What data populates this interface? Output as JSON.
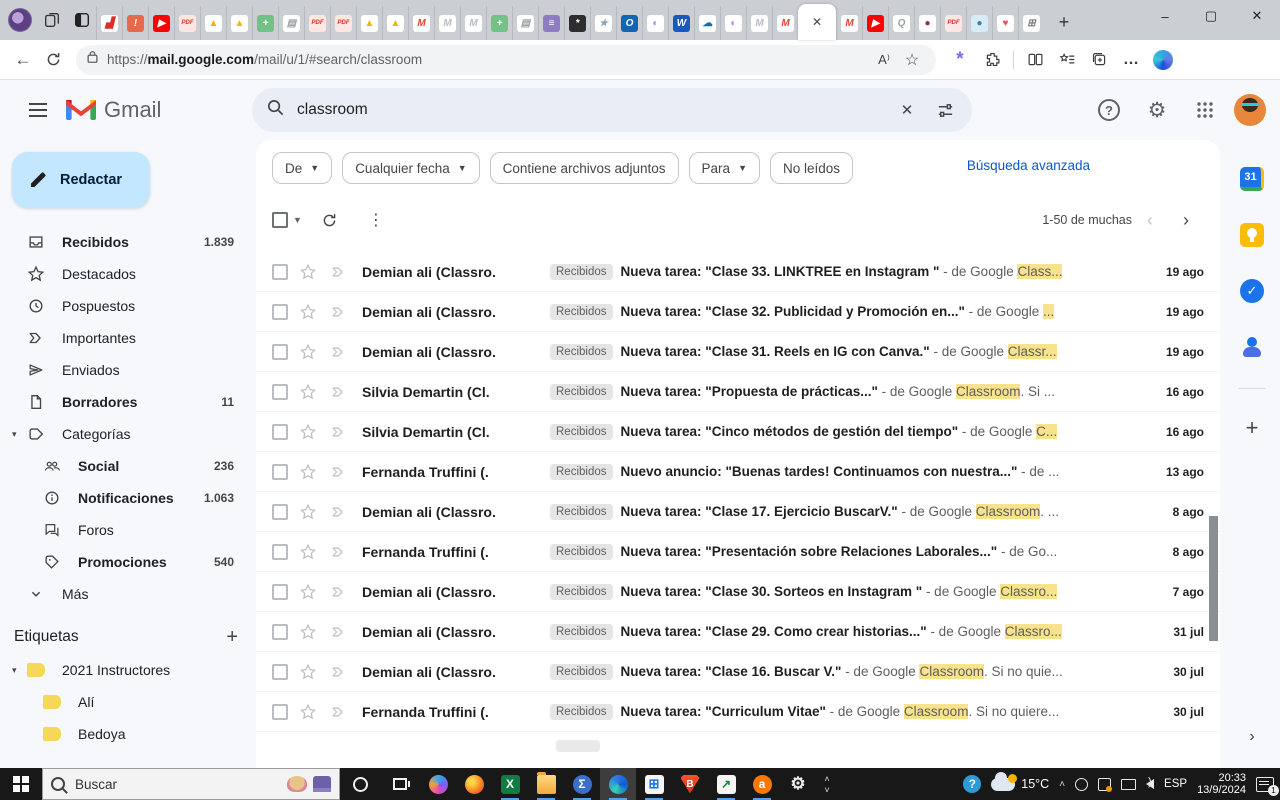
{
  "browser": {
    "window": {
      "minimize": "–",
      "maximize": "▢",
      "close": "✕"
    },
    "active_tab_close": "✕",
    "new_tab": "+",
    "tabs_before": [
      {
        "name": "analytics",
        "bg": "#ffffff",
        "fg": "#d93025",
        "g": "▟"
      },
      {
        "name": "alert-orange",
        "bg": "#e8684a",
        "fg": "#ffffff",
        "g": "!"
      },
      {
        "name": "youtube",
        "bg": "#ff0000",
        "fg": "#ffffff",
        "g": "▶"
      },
      {
        "name": "pdf",
        "bg": "#fde7e5",
        "fg": "#d93025",
        "g": "PDF"
      },
      {
        "name": "drive",
        "bg": "#ffffff",
        "fg": "#f4b400",
        "g": "▲"
      },
      {
        "name": "drive",
        "bg": "#ffffff",
        "fg": "#f4b400",
        "g": "▲"
      },
      {
        "name": "sheets",
        "bg": "#71c287",
        "fg": "#ffffff",
        "g": "+"
      },
      {
        "name": "doc",
        "bg": "#ffffff",
        "fg": "#9aa0a6",
        "g": "▤"
      },
      {
        "name": "pdf",
        "bg": "#fde7e5",
        "fg": "#d93025",
        "g": "PDF"
      },
      {
        "name": "pdf",
        "bg": "#fde7e5",
        "fg": "#d93025",
        "g": "PDF"
      },
      {
        "name": "drive",
        "bg": "#ffffff",
        "fg": "#f4b400",
        "g": "▲"
      },
      {
        "name": "drive",
        "bg": "#ffffff",
        "fg": "#f4b400",
        "g": "▲"
      },
      {
        "name": "gmail",
        "bg": "#ffffff",
        "fg": "#ea4335",
        "g": "M"
      },
      {
        "name": "mail-muted",
        "bg": "#ffffff",
        "fg": "#b5bdc9",
        "g": "M"
      },
      {
        "name": "mail-muted",
        "bg": "#ffffff",
        "fg": "#b5bdc9",
        "g": "M"
      },
      {
        "name": "sheets",
        "bg": "#71c287",
        "fg": "#ffffff",
        "g": "+"
      },
      {
        "name": "doc",
        "bg": "#ffffff",
        "fg": "#9aa0a6",
        "g": "▤"
      },
      {
        "name": "list-purple",
        "bg": "#8e7cc3",
        "fg": "#ffffff",
        "g": "≡"
      },
      {
        "name": "openai",
        "bg": "#2d2d2d",
        "fg": "#ffffff",
        "g": "*"
      },
      {
        "name": "star-muted",
        "bg": "#ffffff",
        "fg": "#8fa6b8",
        "g": "★"
      },
      {
        "name": "outlook",
        "bg": "#1066b5",
        "fg": "#ffffff",
        "g": "O"
      },
      {
        "name": "loop-purple",
        "bg": "#ffffff",
        "fg": "#9b8ae0",
        "g": "◐"
      },
      {
        "name": "word",
        "bg": "#185abd",
        "fg": "#ffffff",
        "g": "W"
      },
      {
        "name": "onedrive",
        "bg": "#ffffff",
        "fg": "#0f6cbd",
        "g": "☁"
      },
      {
        "name": "loop-purple",
        "bg": "#ffffff",
        "fg": "#9b8ae0",
        "g": "◐"
      },
      {
        "name": "mail-muted",
        "bg": "#ffffff",
        "fg": "#b5bdc9",
        "g": "M"
      },
      {
        "name": "gmail",
        "bg": "#ffffff",
        "fg": "#ea4335",
        "g": "M"
      }
    ],
    "tabs_after": [
      {
        "name": "gmail",
        "bg": "#ffffff",
        "fg": "#ea4335",
        "g": "M"
      },
      {
        "name": "youtube",
        "bg": "#ff0000",
        "fg": "#ffffff",
        "g": "▶"
      },
      {
        "name": "search-muted",
        "bg": "#ffffff",
        "fg": "#9aa0a6",
        "g": "Q"
      },
      {
        "name": "circle-darkred",
        "bg": "#ffffff",
        "fg": "#93323b",
        "g": "●"
      },
      {
        "name": "pdf",
        "bg": "#fde7e5",
        "fg": "#d93025",
        "g": "PDF"
      },
      {
        "name": "globe-blue",
        "bg": "#d8ecf7",
        "fg": "#3b82a8",
        "g": "●"
      },
      {
        "name": "heart",
        "bg": "#ffffff",
        "fg": "#e25563",
        "g": "♥"
      },
      {
        "name": "ms-grid",
        "bg": "#ffffff",
        "fg": "#7c7c7c",
        "g": "⊞"
      }
    ],
    "toolbar": {
      "back": "←",
      "url_scheme": "https://",
      "url_host": "mail.google.com",
      "url_path": "/mail/u/1/#search/classroom",
      "read_aloud": "A⁾",
      "favorite_star": "☆",
      "more": "…"
    }
  },
  "gmail": {
    "brand": "Gmail",
    "search": {
      "value": "classroom",
      "clear": "✕"
    },
    "compose": "Redactar",
    "filters": [
      {
        "label": "De",
        "dropdown": true
      },
      {
        "label": "Cualquier fecha",
        "dropdown": true
      },
      {
        "label": "Contiene archivos adjuntos",
        "dropdown": false
      },
      {
        "label": "Para",
        "dropdown": true
      },
      {
        "label": "No leídos",
        "dropdown": false
      }
    ],
    "advanced_search": "Búsqueda avanzada",
    "nav": [
      {
        "icon": "inbox",
        "label": "Recibidos",
        "count": "1.839",
        "bold": true
      },
      {
        "icon": "star",
        "label": "Destacados",
        "count": ""
      },
      {
        "icon": "clock",
        "label": "Pospuestos",
        "count": ""
      },
      {
        "icon": "important",
        "label": "Importantes",
        "count": ""
      },
      {
        "icon": "send",
        "label": "Enviados",
        "count": ""
      },
      {
        "icon": "doc",
        "label": "Borradores",
        "count": "11",
        "bold": true
      },
      {
        "icon": "tag",
        "label": "Categorías",
        "count": "",
        "expander": true
      },
      {
        "icon": "people",
        "label": "Social",
        "count": "236",
        "bold": true,
        "indent": true
      },
      {
        "icon": "info",
        "label": "Notificaciones",
        "count": "1.063",
        "bold": true,
        "indent": true
      },
      {
        "icon": "chat",
        "label": "Foros",
        "count": "",
        "indent": true
      },
      {
        "icon": "promo",
        "label": "Promociones",
        "count": "540",
        "bold": true,
        "indent": true
      },
      {
        "icon": "chevron",
        "label": "Más",
        "count": ""
      }
    ],
    "labels_header": {
      "title": "Etiquetas",
      "add": "+"
    },
    "labels": [
      {
        "label": "2021 Instructores",
        "expander": true
      },
      {
        "label": "Alí",
        "indent": true
      },
      {
        "label": "Bedoya",
        "indent": true
      }
    ],
    "list_toolbar": {
      "range": "1-50 de muchas",
      "prev": "‹",
      "next": "›"
    },
    "emails": [
      {
        "sender": "Demian ali (Classro.",
        "chip": "Recibidos",
        "subject": "Nueva tarea: \"Clase 33. LINKTREE en Instagram \"",
        "pre": " - de Google ",
        "hl": "Class...",
        "post": "",
        "date": "19 ago"
      },
      {
        "sender": "Demian ali (Classro.",
        "chip": "Recibidos",
        "subject": "Nueva tarea: \"Clase 32. Publicidad y Promoción en...\"",
        "pre": " - de Google ",
        "hl": "...",
        "post": "",
        "date": "19 ago"
      },
      {
        "sender": "Demian ali (Classro.",
        "chip": "Recibidos",
        "subject": "Nueva tarea: \"Clase 31. Reels en IG con Canva.\"",
        "pre": " - de Google ",
        "hl": "Classr...",
        "post": "",
        "date": "19 ago"
      },
      {
        "sender": "Silvia Demartin (Cl.",
        "chip": "Recibidos",
        "subject": "Nueva tarea: \"Propuesta de prácticas...\"",
        "pre": " - de Google ",
        "hl": "Classroom",
        "post": ". Si ...",
        "date": "16 ago"
      },
      {
        "sender": "Silvia Demartin (Cl.",
        "chip": "Recibidos",
        "subject": "Nueva tarea: \"Cinco métodos de gestión del tiempo\"",
        "pre": " - de Google ",
        "hl": "C...",
        "post": "",
        "date": "16 ago"
      },
      {
        "sender": "Fernanda Truffini (.",
        "chip": "Recibidos",
        "subject": "Nuevo anuncio: \"Buenas tardes! Continuamos con nuestra...\"",
        "pre": " - de ...",
        "hl": "",
        "post": "",
        "date": "13 ago"
      },
      {
        "sender": "Demian ali (Classro.",
        "chip": "Recibidos",
        "subject": "Nueva tarea: \"Clase 17. Ejercicio BuscarV.\"",
        "pre": " - de Google ",
        "hl": "Classroom",
        "post": ". ...",
        "date": "8 ago"
      },
      {
        "sender": "Fernanda Truffini (.",
        "chip": "Recibidos",
        "subject": "Nueva tarea: \"Presentación sobre Relaciones Laborales...\"",
        "pre": " - de Go...",
        "hl": "",
        "post": "",
        "date": "8 ago"
      },
      {
        "sender": "Demian ali (Classro.",
        "chip": "Recibidos",
        "subject": "Nueva tarea: \"Clase 30. Sorteos en Instagram \"",
        "pre": " - de Google ",
        "hl": "Classro...",
        "post": "",
        "date": "7 ago"
      },
      {
        "sender": "Demian ali (Classro.",
        "chip": "Recibidos",
        "subject": "Nueva tarea: \"Clase 29. Como crear historias...\"",
        "pre": " - de Google ",
        "hl": "Classro...",
        "post": "",
        "date": "31 jul"
      },
      {
        "sender": "Demian ali (Classro.",
        "chip": "Recibidos",
        "subject": "Nueva tarea: \"Clase 16. Buscar V.\"",
        "pre": " - de Google ",
        "hl": "Classroom",
        "post": ". Si no quie...",
        "date": "30 jul"
      },
      {
        "sender": "Fernanda Truffini (.",
        "chip": "Recibidos",
        "subject": "Nueva tarea: \"Curriculum Vitae\"",
        "pre": " - de Google ",
        "hl": "Classroom",
        "post": ". Si no quiere...",
        "date": "30 jul"
      }
    ],
    "side_panel_expand": "›"
  },
  "taskbar": {
    "search_placeholder": "Buscar",
    "apps": [
      {
        "name": "copilot",
        "kind": "copilot",
        "g": ""
      },
      {
        "name": "firefox",
        "kind": "firefox",
        "g": ""
      },
      {
        "name": "excel",
        "kind": "excel",
        "g": "X",
        "running": true
      },
      {
        "name": "file-explorer",
        "kind": "explorer",
        "g": "",
        "running": true
      },
      {
        "name": "math-input",
        "kind": "sigma",
        "g": "Σ",
        "running": true
      },
      {
        "name": "edge",
        "kind": "edge",
        "g": "",
        "running": true,
        "active": true
      },
      {
        "name": "microsoft-store",
        "kind": "store",
        "g": "⊞",
        "running": true
      },
      {
        "name": "brave",
        "kind": "brave",
        "g": "B"
      },
      {
        "name": "stocks",
        "kind": "stocks",
        "g": "↗",
        "running": true
      },
      {
        "name": "avast",
        "kind": "avast",
        "g": "a",
        "running": true
      },
      {
        "name": "settings",
        "kind": "settings",
        "g": "⚙"
      }
    ],
    "temperature": "15°C",
    "language": "ESP",
    "time": "20:33",
    "date": "13/9/2024",
    "notification_badge": "1"
  }
}
